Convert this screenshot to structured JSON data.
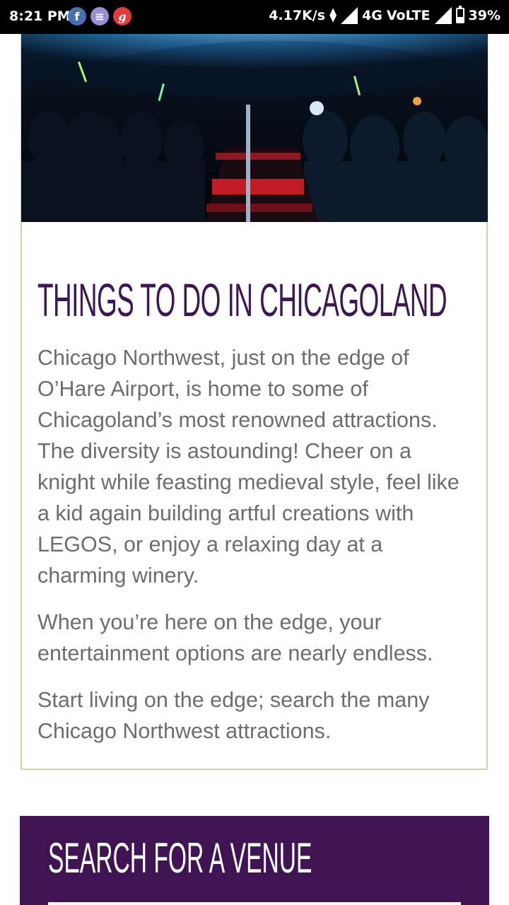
{
  "status_bar": {
    "time": "8:21 PM",
    "notifications": [
      {
        "icon": "facebook-icon",
        "glyph": "f"
      },
      {
        "icon": "messenger-icon",
        "glyph": "≡"
      },
      {
        "icon": "gaana-icon",
        "glyph": "g"
      }
    ],
    "network_speed": "4.17K/s",
    "network_type": "4G",
    "volte": "VoLTE",
    "battery_percent": "39%",
    "battery_level": 0.39
  },
  "attractions": {
    "title": "THINGS TO DO IN CHICAGOLAND",
    "paragraphs": [
      "Chicago Northwest, just on the edge of O’Hare Airport, is home to some of Chicagoland’s most renowned attractions. The diversity is astounding! Cheer on a knight while feasting medieval style, feel like a kid again building artful creations with LEGOS, or enjoy a relaxing day at a charming winery.",
      "When you’re here on the edge, your entertainment options are nearly endless.",
      "Start living on the edge; search the many Chicago Northwest attractions."
    ]
  },
  "search": {
    "title": "SEARCH FOR A VENUE"
  },
  "colors": {
    "title_purple": "#3c1752",
    "panel_purple": "#401452",
    "card_border": "#c6d7a5",
    "body_text": "#6d6d6d"
  }
}
